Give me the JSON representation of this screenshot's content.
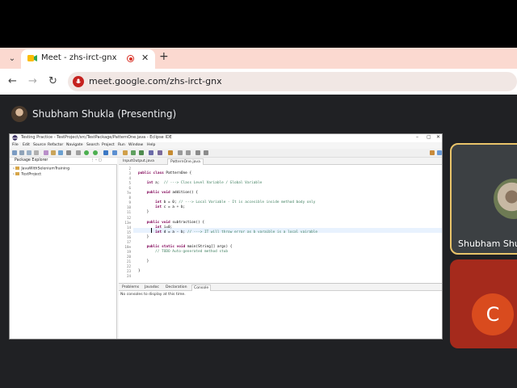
{
  "browser": {
    "tab_title": "Meet - zhs-irct-gnx",
    "url": "meet.google.com/zhs-irct-gnx",
    "accent": "#fbd9d0"
  },
  "meet": {
    "presenter_label": "Shubham Shukla (Presenting)",
    "participants": [
      {
        "name": "Shubham Shu",
        "highlight_color": "#e9c46a"
      },
      {
        "initial": "C",
        "color": "#d94b1e"
      }
    ]
  },
  "eclipse": {
    "window_title": "Testing Practice - TestProject/src/TestPackage/PatternOne.java - Eclipse IDE",
    "menu": [
      "File",
      "Edit",
      "Source",
      "Refactor",
      "Navigate",
      "Search",
      "Project",
      "Run",
      "Window",
      "Help"
    ],
    "package_explorer": {
      "title": "Package Explorer",
      "projects": [
        "JavaWithSeleniumTraining",
        "TestProject"
      ]
    },
    "editor_tabs": [
      "InputOutput.java",
      "PatternOne.java"
    ],
    "code_lines": [
      {
        "n": "2",
        "text": ""
      },
      {
        "n": "3",
        "text": "public class PatternOne {"
      },
      {
        "n": "4",
        "text": ""
      },
      {
        "n": "5",
        "text": "    int a;  // ---> Class Level Variable / Global Variable"
      },
      {
        "n": "6",
        "text": ""
      },
      {
        "n": "7⊖",
        "text": "    public void addition() {"
      },
      {
        "n": "8",
        "text": ""
      },
      {
        "n": "9",
        "text": "        int b = 0; // ---> Local Variable - It is accesible inside method body only"
      },
      {
        "n": "10",
        "text": "        int c = a + b;"
      },
      {
        "n": "11",
        "text": "    }"
      },
      {
        "n": "12",
        "text": ""
      },
      {
        "n": "13⊖",
        "text": "    public void subtraction() {"
      },
      {
        "n": "14",
        "text": "        int i=0;"
      },
      {
        "n": "15",
        "text": "        int d = a - b; // ---> IT will throw error as b varaible is a local vairable"
      },
      {
        "n": "16",
        "text": "    }"
      },
      {
        "n": "17",
        "text": ""
      },
      {
        "n": "18⊖",
        "text": "    public static void main(String[] args) {"
      },
      {
        "n": "19",
        "text": "        // TODO Auto-generated method stub"
      },
      {
        "n": "20",
        "text": ""
      },
      {
        "n": "21",
        "text": "    }"
      },
      {
        "n": "22",
        "text": ""
      },
      {
        "n": "23",
        "text": "}"
      },
      {
        "n": "24",
        "text": ""
      }
    ],
    "bottom_tabs": [
      "Problems",
      "Javadoc",
      "Declaration",
      "Console"
    ],
    "console_message": "No consoles to display at this time."
  }
}
